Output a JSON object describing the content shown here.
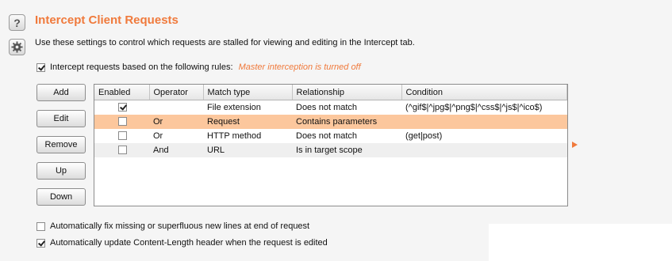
{
  "section": {
    "title": "Intercept Client Requests",
    "description": "Use these settings to control which requests are stalled for viewing and editing in the Intercept tab."
  },
  "icons": {
    "help": "?",
    "gear": "gear-icon"
  },
  "intercept_rules": {
    "label": "Intercept requests based on the following rules:",
    "checked": true,
    "warning": "Master interception is turned off"
  },
  "buttons": {
    "add": "Add",
    "edit": "Edit",
    "remove": "Remove",
    "up": "Up",
    "down": "Down"
  },
  "table": {
    "headers": [
      "Enabled",
      "Operator",
      "Match type",
      "Relationship",
      "Condition"
    ],
    "rows": [
      {
        "enabled": true,
        "operator": "",
        "match_type": "File extension",
        "relationship": "Does not match",
        "condition": "(^gif$|^jpg$|^png$|^css$|^js$|^ico$)"
      },
      {
        "enabled": false,
        "operator": "Or",
        "match_type": "Request",
        "relationship": "Contains parameters",
        "condition": ""
      },
      {
        "enabled": false,
        "operator": "Or",
        "match_type": "HTTP method",
        "relationship": "Does not match",
        "condition": "(get|post)"
      },
      {
        "enabled": false,
        "operator": "And",
        "match_type": "URL",
        "relationship": "Is in target scope",
        "condition": ""
      }
    ]
  },
  "options": {
    "fix_newlines": {
      "label": "Automatically fix missing or superfluous new lines at end of request",
      "checked": false
    },
    "update_content_length": {
      "label": "Automatically update Content-Length header when the request is edited",
      "checked": true
    }
  },
  "colors": {
    "accent": "#f07a3c",
    "selected_row": "#fcc79d"
  }
}
